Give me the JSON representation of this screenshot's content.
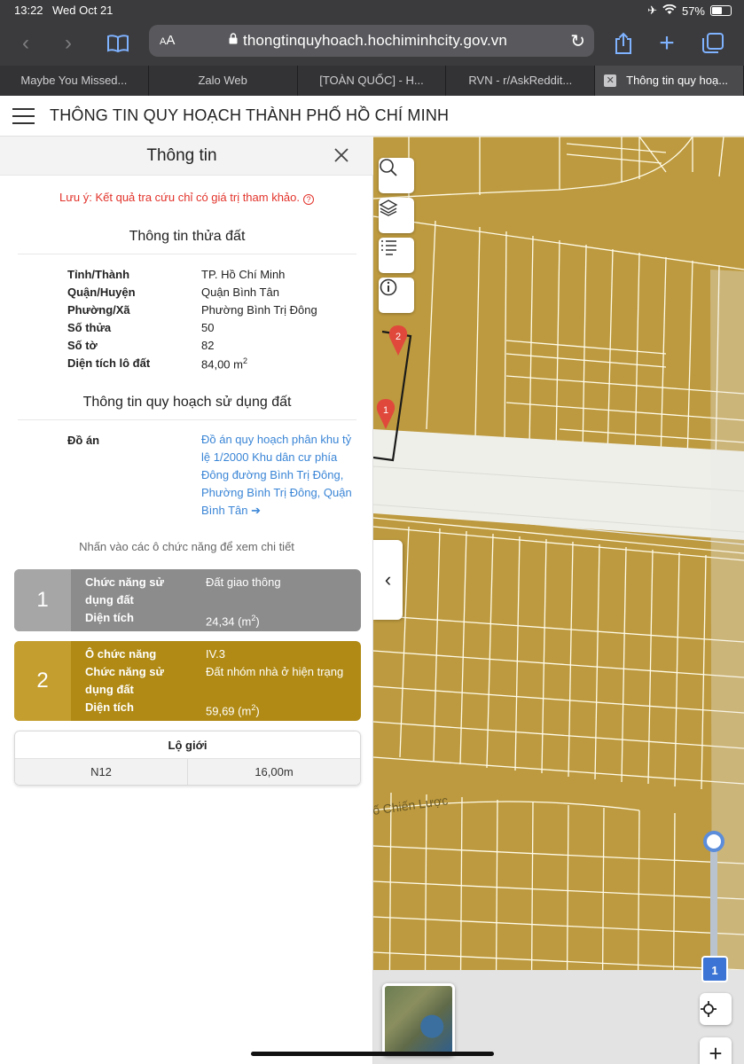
{
  "status": {
    "time": "13:22",
    "date": "Wed Oct 21",
    "battery": "57%",
    "battery_level": 0.57
  },
  "browser": {
    "url": "thongtinquyhoach.hochiminhcity.gov.vn",
    "aa_label": "AA",
    "tabs": [
      {
        "label": "Maybe You Missed..."
      },
      {
        "label": "Zalo Web"
      },
      {
        "label": "[TOÀN QUỐC] - H..."
      },
      {
        "label": "RVN - r/AskReddit..."
      },
      {
        "label": "Thông tin quy hoạ..."
      }
    ]
  },
  "site": {
    "title": "THÔNG TIN QUY HOẠCH THÀNH PHỐ HỒ CHÍ MINH"
  },
  "panel": {
    "title": "Thông tin",
    "note": "Lưu ý: Kết quả tra cứu chỉ có giá trị tham khảo.",
    "parcel_title": "Thông tin thửa đất",
    "parcel": [
      {
        "key": "Tỉnh/Thành",
        "value": "TP. Hồ Chí Minh"
      },
      {
        "key": "Quận/Huyện",
        "value": "Quận Bình Tân"
      },
      {
        "key": "Phường/Xã",
        "value": "Phường Bình Trị Đông"
      },
      {
        "key": "Số thửa",
        "value": "50"
      },
      {
        "key": "Số tờ",
        "value": "82"
      },
      {
        "key": "Diện tích lô đất",
        "value": "84,00 m",
        "value_sup": "2"
      }
    ],
    "plan_title": "Thông tin quy hoạch sử dụng đất",
    "plan_key": "Đồ án",
    "plan_link": "Đồ án quy hoạch phân khu tỷ lệ 1/2000 Khu dân cư phía Đông đường Bình Trị Đông, Phường Bình Trị Đông, Quận Bình Tân",
    "plan_link_arrow": "➔",
    "hint": "Nhấn vào các ô chức năng để xem chi tiết",
    "cards": [
      {
        "number": "1",
        "rows": [
          {
            "key": "Chức năng sử dụng đất",
            "value": "Đất giao thông"
          },
          {
            "key": "Diện tích",
            "value": "24,34 (m",
            "sup": "2",
            "tail": ")"
          }
        ]
      },
      {
        "number": "2",
        "rows": [
          {
            "key": "Ô chức năng",
            "value": "IV.3"
          },
          {
            "key": "Chức năng sử dụng đất",
            "value": "Đất nhóm nhà ở hiện trạng"
          },
          {
            "key": "Diện tích",
            "value": "59,69 (m",
            "sup": "2",
            "tail": ")"
          }
        ]
      }
    ],
    "lo_gioi": {
      "header": "Lộ giới",
      "road": "N12",
      "width": "16,00m"
    }
  },
  "map": {
    "street_label": "ố Chiến Lược",
    "markers": [
      {
        "label": "1"
      },
      {
        "label": "2"
      }
    ],
    "zoom_level": "1",
    "collapse_icon": "chevron-left-icon",
    "tools": [
      "search-icon",
      "layers-icon",
      "list-icon",
      "info-icon"
    ],
    "colors": {
      "zone": "#bd9a3f",
      "road": "#f2f2ee",
      "marker": "#e0483c",
      "zoom": "#3b74d4"
    }
  }
}
